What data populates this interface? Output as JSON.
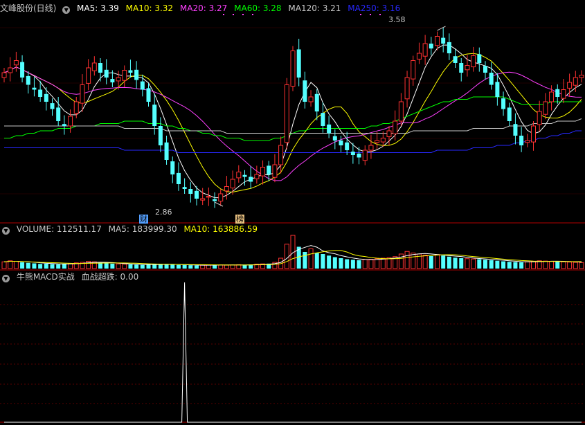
{
  "colors": {
    "up": "#ff3232",
    "down": "#54ffff",
    "ma5": "#ffffff",
    "ma10": "#ffff00",
    "ma20": "#ff40ff",
    "ma60": "#00ff00",
    "ma120": "#c8c8c8",
    "ma250": "#2828ff",
    "border": "#b40000",
    "text": "#c8c8c8"
  },
  "main_header": {
    "title": "文峰股份(日线)",
    "ma5": "MA5: 3.39",
    "ma10": "MA10: 3.32",
    "ma20": "MA20: 3.27",
    "ma60": "MA60: 3.28",
    "ma120": "MA120: 3.21",
    "ma250": "MA250: 3.16"
  },
  "volume_header": {
    "volume": "VOLUME: 112511.17",
    "ma5": "MA5: 183999.30",
    "ma10": "MA10: 163886.59"
  },
  "macd_header": {
    "name": "牛熊MACD实战",
    "signal": "血战超跌: 0.00"
  },
  "annotations": {
    "high": "3.58",
    "low": "2.86",
    "tag_cai": "财",
    "tag_bang": "榜"
  },
  "chart_data": [
    {
      "type": "candlestick",
      "title": "文峰股份(日线)",
      "ylim": [
        2.8,
        3.62
      ],
      "closes": [
        3.4,
        3.42,
        3.45,
        3.38,
        3.35,
        3.33,
        3.3,
        3.28,
        3.25,
        3.2,
        3.18,
        3.22,
        3.28,
        3.35,
        3.42,
        3.44,
        3.4,
        3.38,
        3.36,
        3.38,
        3.41,
        3.4,
        3.37,
        3.33,
        3.28,
        3.18,
        3.1,
        3.04,
        2.98,
        2.94,
        2.92,
        2.9,
        2.88,
        2.88,
        2.89,
        2.87,
        2.9,
        2.93,
        2.96,
        2.99,
        2.97,
        2.95,
        2.98,
        3.01,
        2.98,
        3.02,
        3.1,
        3.35,
        3.49,
        3.38,
        3.28,
        3.3,
        3.24,
        3.18,
        3.15,
        3.12,
        3.1,
        3.08,
        3.06,
        3.05,
        3.08,
        3.1,
        3.12,
        3.13,
        3.16,
        3.2,
        3.28,
        3.38,
        3.45,
        3.48,
        3.52,
        3.5,
        3.55,
        3.52,
        3.48,
        3.44,
        3.4,
        3.43,
        3.47,
        3.44,
        3.4,
        3.35,
        3.3,
        3.25,
        3.2,
        3.14,
        3.1,
        3.12,
        3.18,
        3.24,
        3.28,
        3.32,
        3.3,
        3.33,
        3.36,
        3.38,
        3.39
      ],
      "series": [
        {
          "name": "MA5",
          "color": "#ffffff"
        },
        {
          "name": "MA10",
          "color": "#ffff00"
        },
        {
          "name": "MA20",
          "color": "#ff40ff"
        },
        {
          "name": "MA60",
          "color": "#00ff00"
        },
        {
          "name": "MA120",
          "color": "#c8c8c8"
        },
        {
          "name": "MA250",
          "color": "#2828ff"
        }
      ],
      "ma60_values": [
        3.13,
        3.13,
        3.14,
        3.14,
        3.15,
        3.15,
        3.16,
        3.16,
        3.16,
        3.17,
        3.17,
        3.17,
        3.18,
        3.18,
        3.18,
        3.18,
        3.19,
        3.19,
        3.19,
        3.19,
        3.2,
        3.2,
        3.2,
        3.2,
        3.19,
        3.19,
        3.19,
        3.18,
        3.18,
        3.17,
        3.17,
        3.16,
        3.16,
        3.15,
        3.15,
        3.14,
        3.14,
        3.13,
        3.13,
        3.13,
        3.12,
        3.12,
        3.12,
        3.12,
        3.12,
        3.13,
        3.13,
        3.14,
        3.15,
        3.16,
        3.16,
        3.17,
        3.17,
        3.17,
        3.17,
        3.17,
        3.17,
        3.17,
        3.17,
        3.17,
        3.17,
        3.18,
        3.18,
        3.19,
        3.19,
        3.2,
        3.21,
        3.22,
        3.23,
        3.24,
        3.25,
        3.26,
        3.27,
        3.28,
        3.28,
        3.29,
        3.29,
        3.29,
        3.3,
        3.3,
        3.3,
        3.3,
        3.3,
        3.3,
        3.29,
        3.28,
        3.27,
        3.27,
        3.27,
        3.27,
        3.27,
        3.28,
        3.28,
        3.28,
        3.28,
        3.28,
        3.28
      ],
      "ma120_values": [
        3.18,
        3.18,
        3.18,
        3.18,
        3.18,
        3.18,
        3.18,
        3.18,
        3.18,
        3.18,
        3.18,
        3.18,
        3.18,
        3.18,
        3.18,
        3.18,
        3.18,
        3.18,
        3.18,
        3.18,
        3.17,
        3.17,
        3.17,
        3.17,
        3.17,
        3.17,
        3.17,
        3.16,
        3.16,
        3.16,
        3.16,
        3.16,
        3.16,
        3.16,
        3.16,
        3.16,
        3.16,
        3.15,
        3.15,
        3.15,
        3.15,
        3.15,
        3.15,
        3.15,
        3.15,
        3.15,
        3.15,
        3.15,
        3.15,
        3.15,
        3.15,
        3.15,
        3.15,
        3.15,
        3.15,
        3.15,
        3.15,
        3.15,
        3.15,
        3.15,
        3.15,
        3.15,
        3.15,
        3.15,
        3.15,
        3.15,
        3.15,
        3.15,
        3.16,
        3.16,
        3.16,
        3.16,
        3.16,
        3.16,
        3.16,
        3.16,
        3.16,
        3.16,
        3.17,
        3.17,
        3.17,
        3.17,
        3.17,
        3.17,
        3.18,
        3.18,
        3.18,
        3.18,
        3.19,
        3.19,
        3.19,
        3.19,
        3.2,
        3.2,
        3.2,
        3.2,
        3.21
      ],
      "ma250_values": [
        3.09,
        3.09,
        3.09,
        3.09,
        3.09,
        3.09,
        3.09,
        3.09,
        3.09,
        3.09,
        3.09,
        3.09,
        3.09,
        3.09,
        3.09,
        3.09,
        3.09,
        3.09,
        3.09,
        3.09,
        3.08,
        3.08,
        3.08,
        3.08,
        3.08,
        3.08,
        3.08,
        3.08,
        3.08,
        3.07,
        3.07,
        3.07,
        3.07,
        3.07,
        3.07,
        3.07,
        3.07,
        3.07,
        3.07,
        3.07,
        3.07,
        3.07,
        3.07,
        3.07,
        3.07,
        3.07,
        3.07,
        3.07,
        3.07,
        3.07,
        3.07,
        3.07,
        3.07,
        3.07,
        3.07,
        3.07,
        3.07,
        3.07,
        3.07,
        3.07,
        3.07,
        3.07,
        3.07,
        3.07,
        3.07,
        3.07,
        3.07,
        3.07,
        3.07,
        3.07,
        3.07,
        3.07,
        3.08,
        3.08,
        3.08,
        3.08,
        3.08,
        3.08,
        3.09,
        3.09,
        3.09,
        3.09,
        3.1,
        3.1,
        3.1,
        3.11,
        3.11,
        3.12,
        3.12,
        3.13,
        3.13,
        3.14,
        3.14,
        3.15,
        3.15,
        3.16,
        3.16
      ],
      "high": 3.58,
      "low": 2.86
    },
    {
      "type": "bar",
      "title": "VOLUME",
      "values": [
        130,
        150,
        140,
        120,
        110,
        100,
        90,
        95,
        85,
        80,
        90,
        100,
        110,
        120,
        140,
        130,
        110,
        100,
        95,
        90,
        85,
        80,
        75,
        70,
        80,
        90,
        85,
        80,
        75,
        70,
        70,
        65,
        60,
        65,
        70,
        75,
        70,
        65,
        70,
        75,
        70,
        80,
        85,
        90,
        95,
        120,
        200,
        470,
        640,
        420,
        320,
        380,
        300,
        280,
        250,
        220,
        200,
        180,
        170,
        160,
        175,
        180,
        190,
        200,
        210,
        230,
        280,
        330,
        300,
        280,
        260,
        240,
        270,
        250,
        230,
        210,
        200,
        190,
        185,
        180,
        170,
        160,
        150,
        140,
        130,
        125,
        120,
        130,
        140,
        150,
        145,
        140,
        135,
        130,
        125,
        120,
        115
      ],
      "series": [
        {
          "name": "MA5",
          "color": "#ffffff"
        },
        {
          "name": "MA10",
          "color": "#ffff00"
        }
      ]
    },
    {
      "type": "line",
      "title": "牛熊MACD实战",
      "series": [
        {
          "name": "血战超跌",
          "color": "#ffffff",
          "values": [
            0,
            0,
            0,
            0,
            0,
            0,
            0,
            0,
            0,
            0,
            0,
            0,
            0,
            0,
            0,
            0,
            0,
            0,
            0,
            0,
            0,
            0,
            0,
            0,
            0,
            0,
            0,
            0,
            0,
            0,
            1,
            0,
            0,
            0,
            0,
            0,
            0,
            0,
            0,
            0,
            0,
            0,
            0,
            0,
            0,
            0,
            0,
            0,
            0,
            0,
            0,
            0,
            0,
            0,
            0,
            0,
            0,
            0,
            0,
            0,
            0,
            0,
            0,
            0,
            0,
            0,
            0,
            0,
            0,
            0,
            0,
            0,
            0,
            0,
            0,
            0,
            0,
            0,
            0,
            0,
            0,
            0,
            0,
            0,
            0,
            0,
            0,
            0,
            0,
            0,
            0,
            0,
            0,
            0,
            0,
            0,
            0
          ]
        }
      ],
      "ylim": [
        0,
        1
      ]
    }
  ]
}
